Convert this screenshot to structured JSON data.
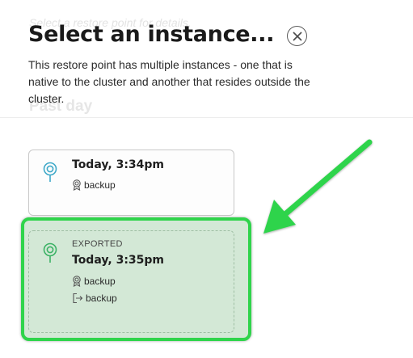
{
  "background": {
    "hint": "Select a restore point for details.",
    "section": "Past day"
  },
  "dialog": {
    "title": "Select an instance...",
    "description": "This restore point has multiple instances - one that is native to the cluster and another that resides outside the cluster.",
    "close_icon": "close-circle-icon"
  },
  "instances": [
    {
      "time": "Today, 3:34pm",
      "tags": [
        {
          "icon": "policy-badge-icon",
          "label": "backup"
        }
      ]
    },
    {
      "kicker": "EXPORTED",
      "time": "Today, 3:35pm",
      "tags": [
        {
          "icon": "policy-badge-icon",
          "label": "backup"
        },
        {
          "icon": "export-icon",
          "label": "backup"
        }
      ]
    }
  ],
  "colors": {
    "highlight_border": "#2fd44b",
    "highlight_fill": "#d3e8d6",
    "pin_native": "#3fa9c9",
    "pin_exported": "#3bb265",
    "annotation_arrow": "#2fd44b"
  }
}
